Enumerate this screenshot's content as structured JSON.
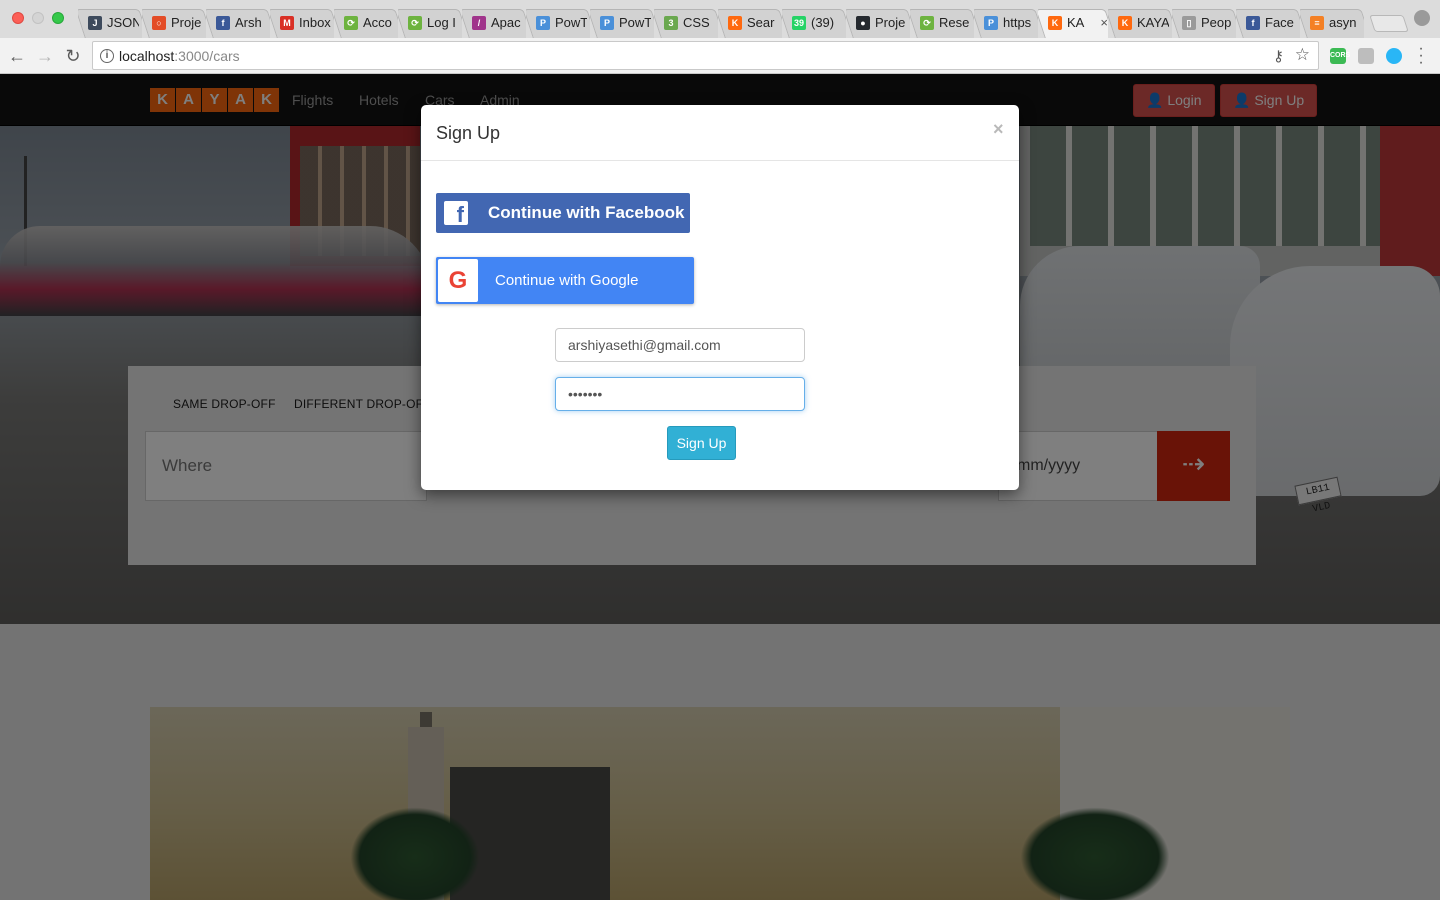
{
  "browser": {
    "tabs": [
      {
        "title": "JSON",
        "icon": "json-icon",
        "color": "#3d4a5c",
        "glyph": "J"
      },
      {
        "title": "Proje",
        "icon": "lifebuoy-icon",
        "color": "#e34c26",
        "glyph": "○"
      },
      {
        "title": "Arsh",
        "icon": "facebook-icon",
        "color": "#3b5998",
        "glyph": "f"
      },
      {
        "title": "Inbox",
        "icon": "gmail-icon",
        "color": "#d93025",
        "glyph": "M"
      },
      {
        "title": "Acco",
        "icon": "refresh-green-icon",
        "color": "#6db33f",
        "glyph": "⟳"
      },
      {
        "title": "Log I",
        "icon": "refresh-green-icon",
        "color": "#6db33f",
        "glyph": "⟳"
      },
      {
        "title": "Apac",
        "icon": "feather-icon",
        "color": "#a0348b",
        "glyph": "/"
      },
      {
        "title": "PowT",
        "icon": "powtoon-icon",
        "color": "#4a90d9",
        "glyph": "P"
      },
      {
        "title": "PowT",
        "icon": "powtoon-icon",
        "color": "#4a90d9",
        "glyph": "P"
      },
      {
        "title": "CSS",
        "icon": "css-icon",
        "color": "#6aa84f",
        "glyph": "3"
      },
      {
        "title": "Sear",
        "icon": "kayak-icon",
        "color": "#ff690f",
        "glyph": "K"
      },
      {
        "title": "(39)",
        "icon": "whatsapp-icon",
        "color": "#25d366",
        "glyph": "39"
      },
      {
        "title": "Proje",
        "icon": "github-icon",
        "color": "#24292e",
        "glyph": "●"
      },
      {
        "title": "Rese",
        "icon": "refresh-green-icon",
        "color": "#6db33f",
        "glyph": "⟳"
      },
      {
        "title": "https",
        "icon": "powtoon-icon",
        "color": "#4a90d9",
        "glyph": "P"
      },
      {
        "title": "KA",
        "icon": "kayak-icon",
        "color": "#ff690f",
        "glyph": "K",
        "active": true
      },
      {
        "title": "KAYA",
        "icon": "kayak-icon",
        "color": "#ff690f",
        "glyph": "K"
      },
      {
        "title": "Peop",
        "icon": "document-icon",
        "color": "#9a9a9a",
        "glyph": "▯"
      },
      {
        "title": "Face",
        "icon": "facebook-icon",
        "color": "#3b5998",
        "glyph": "f"
      },
      {
        "title": "asyn",
        "icon": "stackoverflow-icon",
        "color": "#f48024",
        "glyph": "≡"
      }
    ],
    "url_host": "localhost",
    "url_path": ":3000/cars"
  },
  "navbar": {
    "logo_letters": [
      "K",
      "A",
      "Y",
      "A",
      "K"
    ],
    "links": [
      "Flights",
      "Hotels",
      "Cars",
      "Admin"
    ],
    "login_label": "Login",
    "signup_label": "Sign Up"
  },
  "search": {
    "tabs": [
      "SAME DROP-OFF",
      "DIFFERENT DROP-OFF"
    ],
    "where_placeholder": "Where",
    "date_placeholder": "mm/yyyy",
    "go_glyph": "⇢"
  },
  "hero": {
    "plate_text": "LB11 VLD"
  },
  "modal": {
    "title": "Sign Up",
    "close_glyph": "×",
    "facebook_label": "Continue with Facebook",
    "google_label": "Continue with Google",
    "email_value": "arshiyasethi@gmail.com",
    "password_value": "•••••••",
    "submit_label": "Sign Up"
  },
  "colors": {
    "kayak_orange": "#ff690f",
    "navbar_bg": "#121212",
    "danger_red": "#d9534f",
    "facebook_blue": "#4267b2",
    "google_blue": "#4285f4",
    "info_cyan": "#31b0d5"
  }
}
